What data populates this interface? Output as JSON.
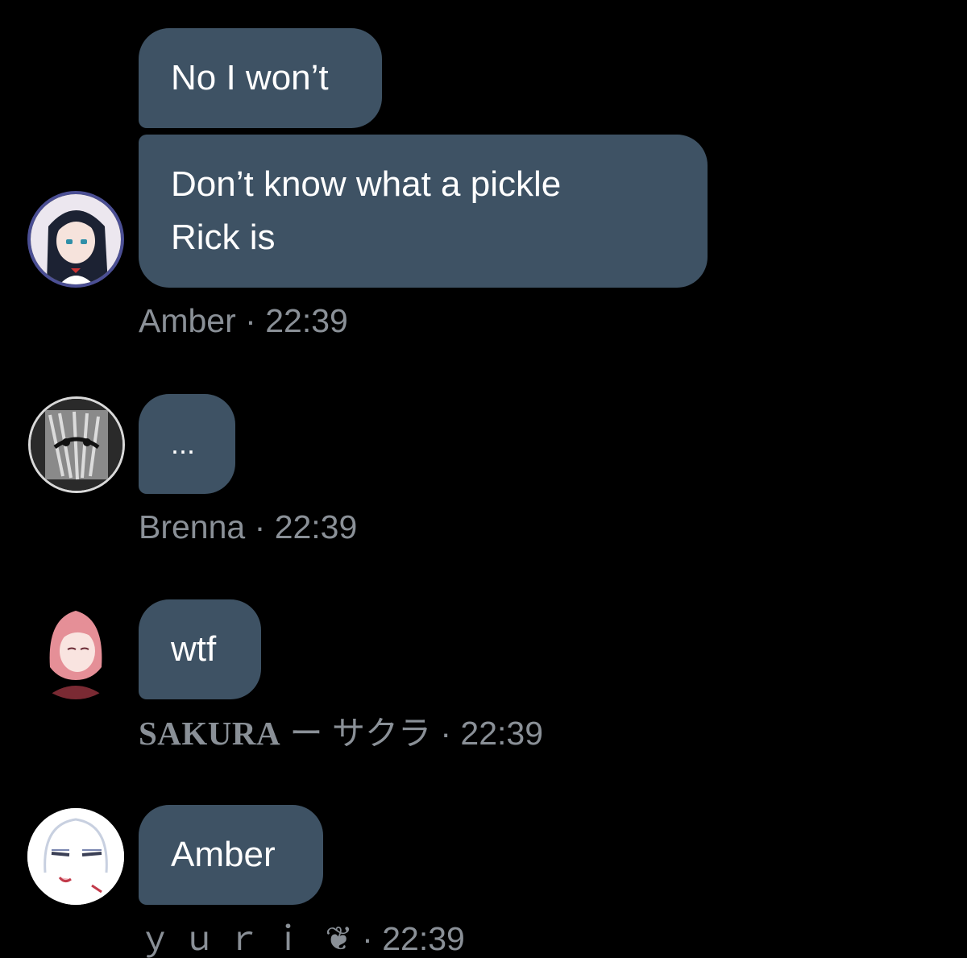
{
  "colors": {
    "background": "#000000",
    "bubble": "#3e5264",
    "bubble_text": "#ffffff",
    "meta_text": "#8a9097"
  },
  "messages": [
    {
      "sender": "Amber",
      "time": "22:39",
      "separator": "·",
      "avatar_icon": "anime-girl-dark-hair-avatar",
      "bubbles": [
        "No I won’t",
        "Don’t know what a pickle\nRick is"
      ]
    },
    {
      "sender": "Brenna",
      "time": "22:39",
      "separator": "·",
      "avatar_icon": "monochrome-sketch-avatar",
      "bubbles": [
        "..."
      ]
    },
    {
      "sender": "SAKURA",
      "sender_suffix": "ー サクラ",
      "time": "22:39",
      "separator": "·",
      "avatar_icon": "pink-hair-girl-avatar",
      "bubbles": [
        "wtf"
      ]
    },
    {
      "sender": "ｙｕｒｉ",
      "sender_glyph": "❦",
      "time": "22:39",
      "separator": "·",
      "avatar_icon": "sketch-face-avatar",
      "bubbles": [
        "Amber"
      ]
    }
  ]
}
